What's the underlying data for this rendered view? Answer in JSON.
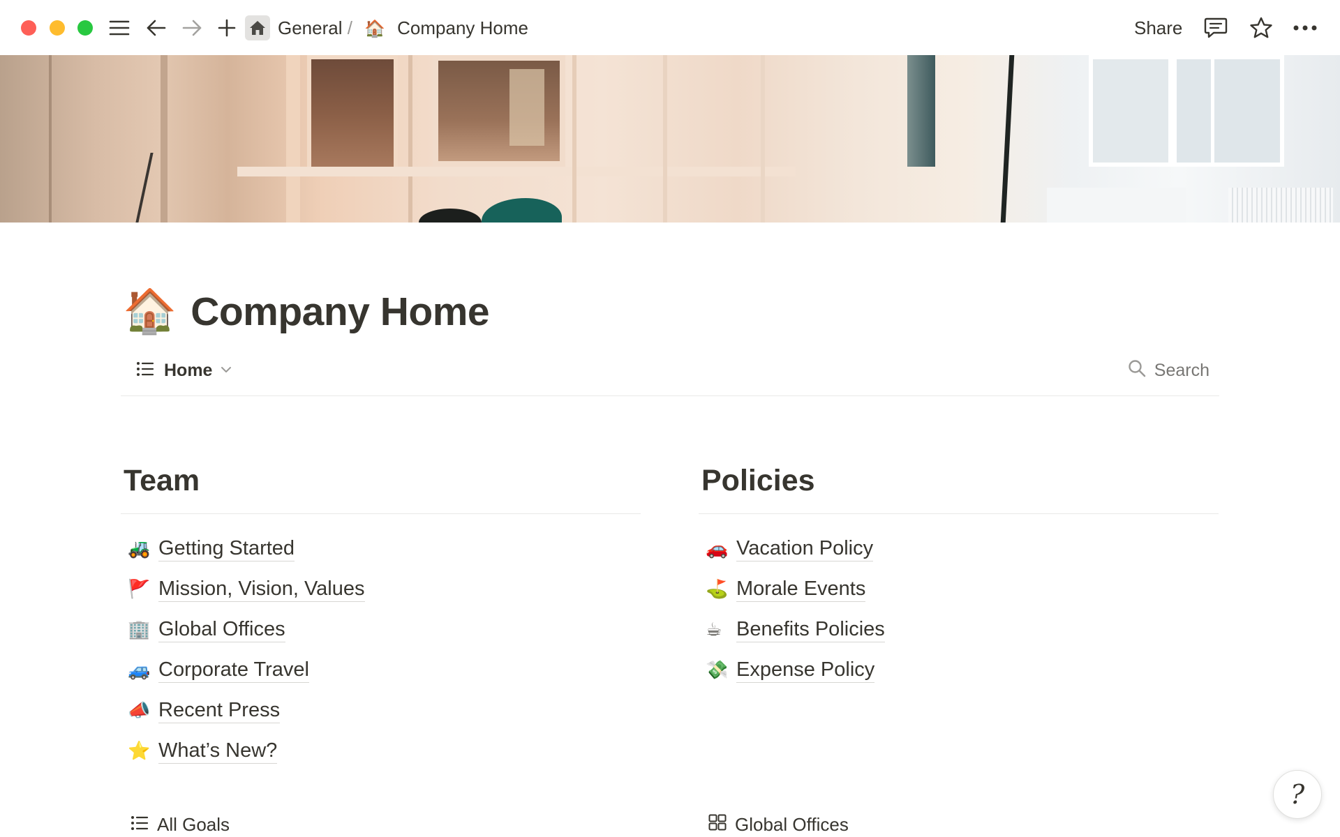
{
  "window": {
    "traffic_lights": {
      "close": "#fe5f57",
      "minimize": "#febc2e",
      "zoom": "#28c840"
    }
  },
  "topbar": {
    "icons": [
      "sidebar-menu-icon",
      "back-arrow-icon",
      "forward-arrow-icon",
      "new-page-plus-icon"
    ],
    "breadcrumb": {
      "workspace_icon": "home-icon",
      "workspace": "General",
      "separator": "/",
      "page_emoji": "🏠",
      "page": "Company Home"
    },
    "share_label": "Share",
    "right_icons": [
      "comments-icon",
      "favorite-star-icon",
      "more-dots-icon"
    ]
  },
  "cover": {
    "description_icon": "office-cover-image"
  },
  "page": {
    "emoji": "🏠",
    "title": "Company Home"
  },
  "view": {
    "tab_icon": "list-icon",
    "tab_label": "Home",
    "search_label": "Search"
  },
  "team": {
    "heading": "Team",
    "items": [
      {
        "emoji": "🚜",
        "label": "Getting Started"
      },
      {
        "emoji": "🚩",
        "label": "Mission, Vision, Values"
      },
      {
        "emoji": "🏢",
        "label": "Global Offices"
      },
      {
        "emoji": "🚙",
        "label": "Corporate Travel"
      },
      {
        "emoji": "📣",
        "label": "Recent Press"
      },
      {
        "emoji": "⭐",
        "label": "What’s New?"
      }
    ]
  },
  "policies": {
    "heading": "Policies",
    "items": [
      {
        "emoji": "🚗",
        "label": "Vacation Policy"
      },
      {
        "emoji": "⛳",
        "label": "Morale Events"
      },
      {
        "emoji": "☕",
        "label": "Benefits Policies"
      },
      {
        "emoji": "💸",
        "label": "Expense Policy"
      }
    ]
  },
  "databases": {
    "left": {
      "icon": "list-icon",
      "label": "All Goals"
    },
    "right": {
      "icon": "gallery-grid-icon",
      "label": "Global Offices"
    }
  },
  "help_button": {
    "glyph": "?"
  }
}
